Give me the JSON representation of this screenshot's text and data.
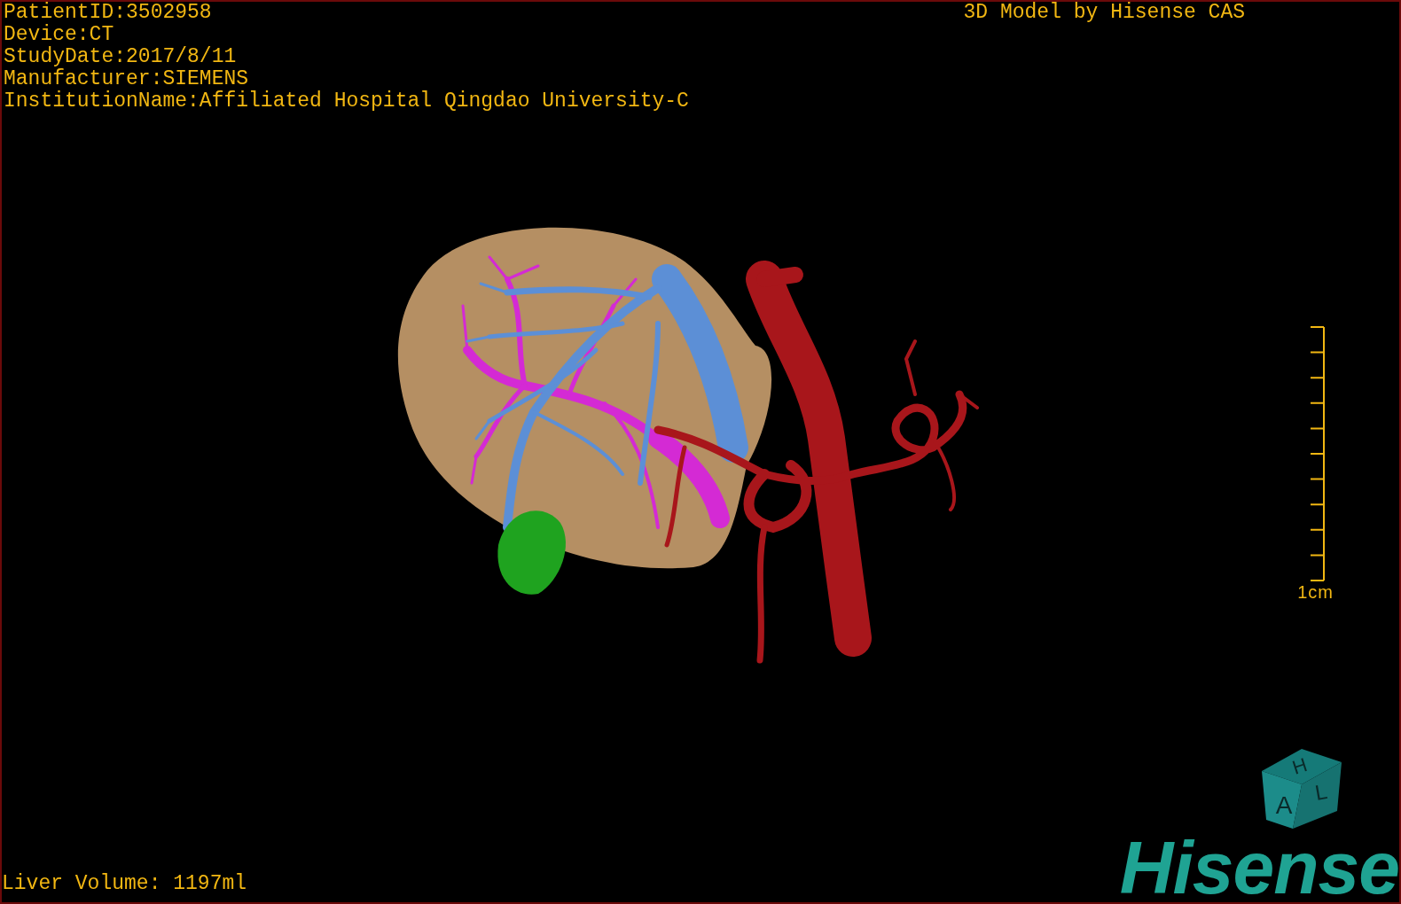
{
  "info_lines": [
    "PatientID:3502958",
    "Device:CT",
    "StudyDate:2017/8/11",
    "Manufacturer:SIEMENS",
    "InstitutionName:Affiliated Hospital Qingdao University-C"
  ],
  "title": "3D Model by Hisense CAS",
  "scale_bar": {
    "label": "1cm"
  },
  "volume": "Liver Volume: 1197ml",
  "orientation_cube": {
    "top": "H",
    "front": "A",
    "side": "L"
  },
  "logo": {
    "text": "Hisense"
  }
}
